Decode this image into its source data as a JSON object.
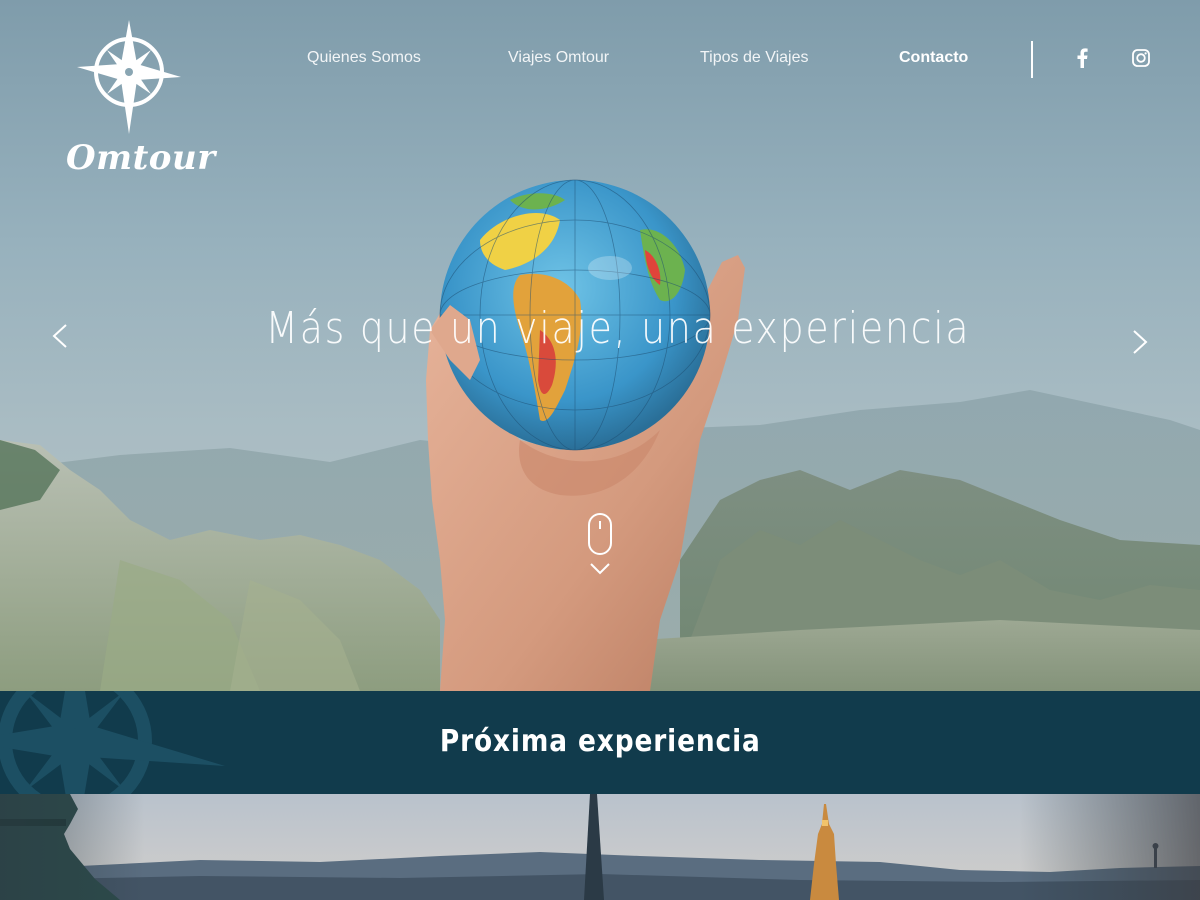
{
  "brand": {
    "name": "Omtour"
  },
  "nav": {
    "items": [
      {
        "label": "Quienes Somos"
      },
      {
        "label": "Viajes Omtour"
      },
      {
        "label": "Tipos de Viajes"
      },
      {
        "label": "Contacto"
      }
    ],
    "social": [
      {
        "icon": "facebook-icon"
      },
      {
        "icon": "instagram-icon"
      }
    ]
  },
  "hero": {
    "title": "Más que un viaje, una experiencia",
    "prev_icon": "chevron-left-icon",
    "next_icon": "chevron-right-icon",
    "scroll_icon": "mouse-scroll-icon"
  },
  "banner": {
    "title": "Próxima experiencia"
  },
  "colors": {
    "banner": "#113b4c",
    "text": "#ffffff",
    "sky": "#93aeb9"
  }
}
